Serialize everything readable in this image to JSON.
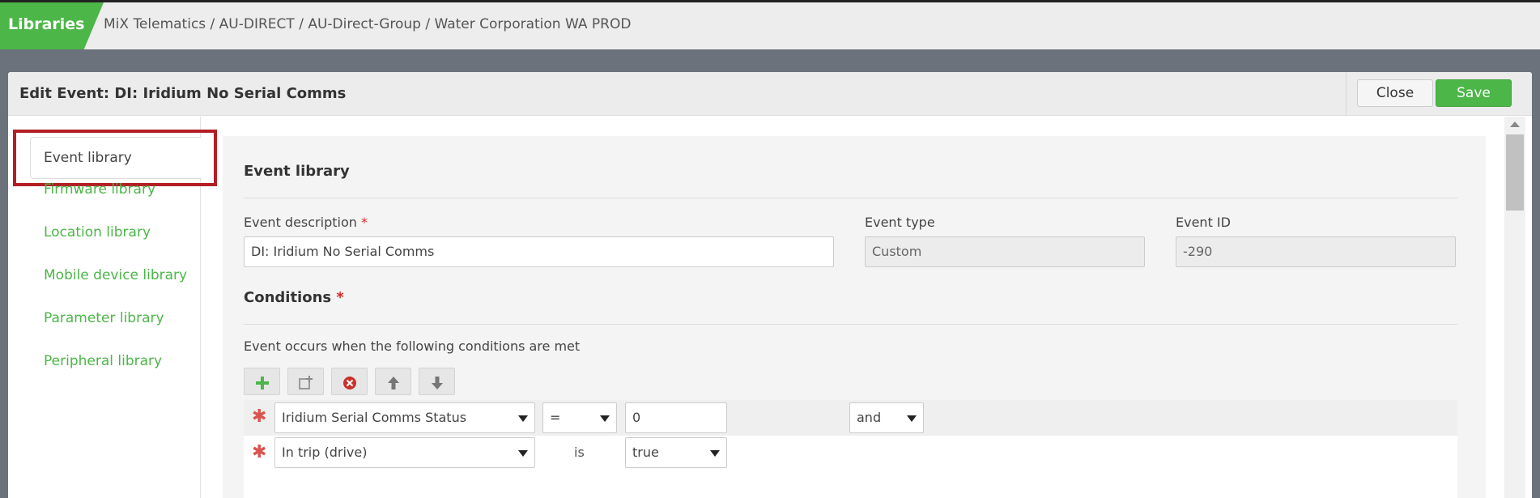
{
  "topbar": {
    "libraries_label": "Libraries",
    "breadcrumb": "MiX Telematics / AU-DIRECT / AU-Direct-Group / Water Corporation WA PROD"
  },
  "dialog": {
    "title": "Edit Event: DI: Iridium No Serial Comms",
    "close_label": "Close",
    "save_label": "Save"
  },
  "sidebar": {
    "items": [
      {
        "label": "Event library",
        "active": true
      },
      {
        "label": "Firmware library"
      },
      {
        "label": "Location library"
      },
      {
        "label": "Mobile device library"
      },
      {
        "label": "Parameter library"
      },
      {
        "label": "Peripheral library"
      }
    ]
  },
  "form": {
    "section_title": "Event library",
    "event_description_label": "Event description",
    "event_description_value": "DI: Iridium No Serial Comms",
    "event_type_label": "Event type",
    "event_type_value": "Custom",
    "event_id_label": "Event ID",
    "event_id_value": "-290",
    "required_marker": "*",
    "conditions_title": "Conditions",
    "conditions_intro": "Event occurs when the following conditions are met"
  },
  "toolbar_icons": [
    "add-icon",
    "add-group-icon",
    "delete-icon",
    "move-up-icon",
    "move-down-icon"
  ],
  "conditions": [
    {
      "field": "Iridium Serial Comms Status",
      "operator": "=",
      "value": "0",
      "join": "and"
    },
    {
      "field": "In trip (drive)",
      "operator": "is",
      "value": "true"
    }
  ],
  "colors": {
    "brand_green": "#4cb648",
    "highlight_red": "#b21f24",
    "required_red": "#d9262c"
  }
}
